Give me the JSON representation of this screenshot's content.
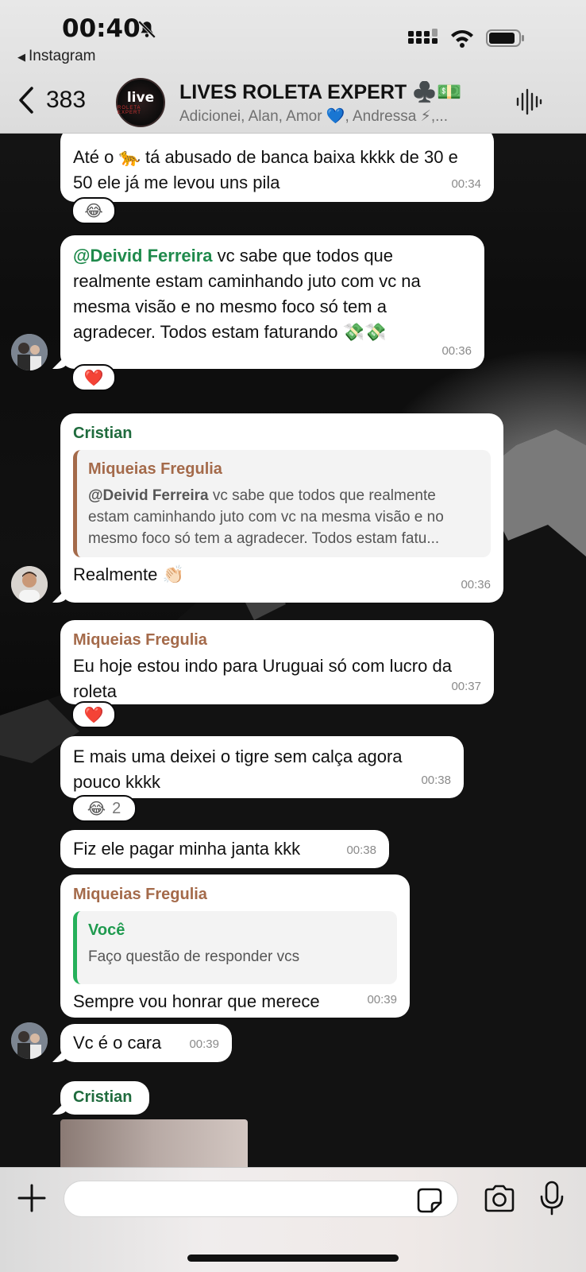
{
  "status_bar": {
    "time": "00:40",
    "back_app": "Instagram"
  },
  "header": {
    "back_count": "383",
    "avatar_text": "live",
    "avatar_subtext": "ROLETA EXPERT",
    "title": "LIVES ROLETA EXPERT ♣️💵",
    "subtitle": "Adicionei, Alan, Amor 💙, Andressa ⚡,..."
  },
  "messages": {
    "m1": {
      "text": "Até o 🐆  tá abusado de banca baixa kkkk  de 30 e 50 ele já me levou uns pila",
      "time": "00:34",
      "reaction": "😂"
    },
    "m2": {
      "mention": "@Deivid Ferreira",
      "text": " vc sabe que todos que realmente estam caminhando juto com vc na mesma visão e no mesmo foco só tem a agradecer. Todos estam faturando 💸💸",
      "time": "00:36",
      "reaction": "❤️"
    },
    "m3": {
      "sender": "Cristian",
      "quote_name": "Miqueias Fregulia",
      "quote_mention": "@Deivid Ferreira",
      "quote_text": " vc sabe que todos que realmente estam caminhando juto com vc na mesma visão e no mesmo foco só tem a agradecer. Todos estam fatu...",
      "text": "Realmente 👏🏻",
      "time": "00:36"
    },
    "m4": {
      "sender": "Miqueias Fregulia",
      "text": "Eu hoje estou indo para Uruguai  só com lucro da roleta",
      "time": "00:37",
      "reaction": "❤️"
    },
    "m5": {
      "text": "E mais uma deixei o tigre sem calça  agora pouco kkkk",
      "time": "00:38",
      "reaction": "😂",
      "reaction_count": "2"
    },
    "m6": {
      "text": "Fiz ele pagar minha janta kkk",
      "time": "00:38"
    },
    "m7": {
      "sender": "Miqueias Fregulia",
      "quote_name": "Você",
      "quote_text": "Faço questão de responder vcs",
      "text": "Sempre vou honrar que merece",
      "time": "00:39"
    },
    "m8": {
      "text": "Vc é o cara",
      "time": "00:39"
    },
    "m9": {
      "sender": "Cristian"
    }
  },
  "composer": {
    "placeholder": ""
  },
  "colors": {
    "sender_green": "#1f6b3d",
    "sender_brown": "#a46a4a",
    "mention_green": "#1f8a4c",
    "quote_bar_green": "#25b05a"
  }
}
